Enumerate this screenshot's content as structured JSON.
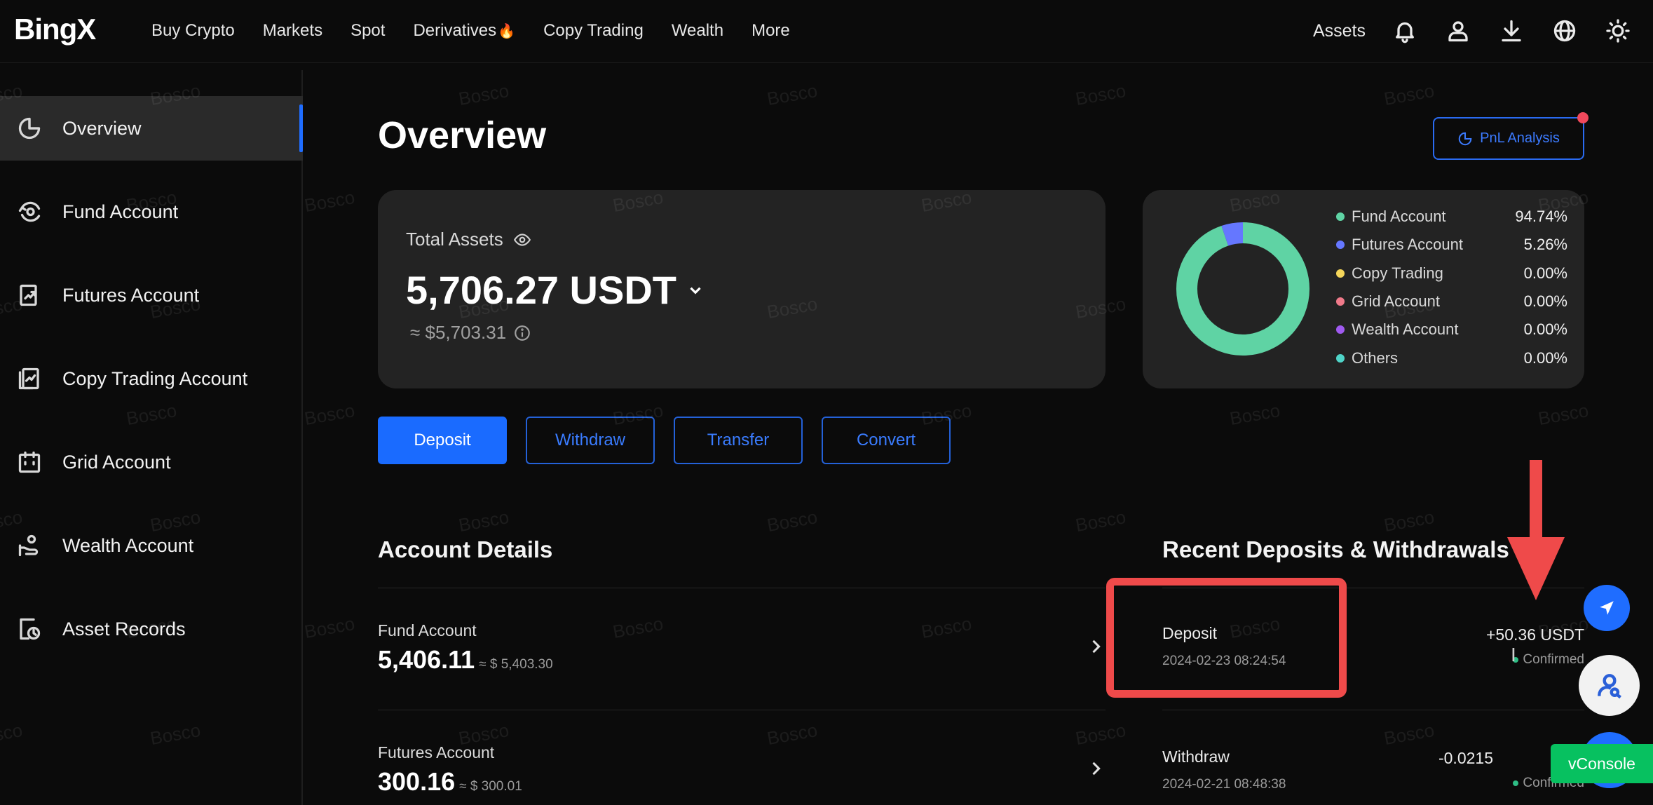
{
  "brand": {
    "logo": "BingX"
  },
  "nav": {
    "items": [
      "Buy Crypto",
      "Markets",
      "Spot",
      "Derivatives",
      "Copy Trading",
      "Wealth",
      "More"
    ],
    "derivatives_badge": "🔥",
    "assets_label": "Assets",
    "icons": [
      "bell-icon",
      "user-icon",
      "download-icon",
      "globe-icon",
      "sun-icon"
    ]
  },
  "sidebar": {
    "items": [
      {
        "label": "Overview",
        "icon": "pie-chart-icon",
        "active": true
      },
      {
        "label": "Fund Account",
        "icon": "fund-icon",
        "active": false
      },
      {
        "label": "Futures Account",
        "icon": "futures-icon",
        "active": false
      },
      {
        "label": "Copy Trading Account",
        "icon": "copy-trading-icon",
        "active": false
      },
      {
        "label": "Grid Account",
        "icon": "grid-icon",
        "active": false
      },
      {
        "label": "Wealth Account",
        "icon": "wealth-icon",
        "active": false
      },
      {
        "label": "Asset Records",
        "icon": "records-icon",
        "active": false
      }
    ]
  },
  "overview": {
    "title": "Overview",
    "pnl_button": "PnL Analysis",
    "total_assets_label": "Total Assets",
    "total_value": "5,706.27 USDT",
    "total_usd": "≈ $5,703.31",
    "allocation": [
      {
        "name": "Fund Account",
        "pct": "94.74%",
        "value": 94.74,
        "color": "#5fd3a4"
      },
      {
        "name": "Futures Account",
        "pct": "5.26%",
        "value": 5.26,
        "color": "#6577ff"
      },
      {
        "name": "Copy Trading",
        "pct": "0.00%",
        "value": 0,
        "color": "#f5d65a"
      },
      {
        "name": "Grid Account",
        "pct": "0.00%",
        "value": 0,
        "color": "#f07a8a"
      },
      {
        "name": "Wealth Account",
        "pct": "0.00%",
        "value": 0,
        "color": "#a05af0"
      },
      {
        "name": "Others",
        "pct": "0.00%",
        "value": 0,
        "color": "#4fd4c8"
      }
    ],
    "actions": [
      "Deposit",
      "Withdraw",
      "Transfer",
      "Convert"
    ]
  },
  "account_details": {
    "title": "Account Details",
    "rows": [
      {
        "name": "Fund Account",
        "value": "5,406.11",
        "approx": "≈ $ 5,403.30"
      },
      {
        "name": "Futures Account",
        "value": "300.16",
        "approx": "≈ $ 300.01"
      }
    ]
  },
  "recent": {
    "title": "Recent Deposits & Withdrawals",
    "rows": [
      {
        "type": "Deposit",
        "date": "2024-02-23 08:24:54",
        "amount": "+50.36 USDT",
        "status": "Confirmed"
      },
      {
        "type": "Withdraw",
        "date": "2024-02-21 08:48:38",
        "amount": "-0.0215",
        "status": "Confirmed"
      }
    ]
  },
  "widgets": {
    "vconsole": "vConsole"
  },
  "watermark": "Bosco",
  "colors": {
    "accent": "#1f6dff",
    "highlight": "#ef4a4a",
    "success": "#2ebd85"
  }
}
